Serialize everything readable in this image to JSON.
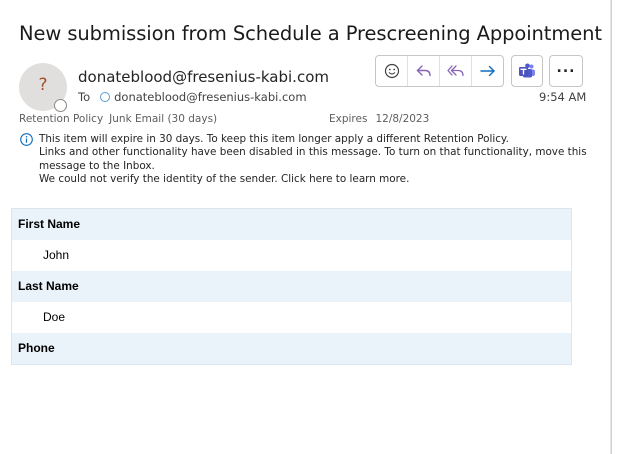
{
  "message": {
    "subject": "New submission from Schedule a Prescreening Appointment",
    "avatar_initial": "?",
    "sender": "donateblood@fresenius-kabi.com",
    "to_label": "To",
    "recipient": "donateblood@fresenius-kabi.com",
    "time": "9:54 AM",
    "retention_label": "Retention Policy",
    "retention_value": "Junk Email (30 days)",
    "expires_label": "Expires",
    "expires_value": "12/8/2023",
    "notice_lines": [
      "This item will expire in 30 days. To keep this item longer apply a different Retention Policy.",
      "Links and other functionality have been disabled in this message. To turn on that functionality, move this message to the Inbox.",
      "We could not verify the identity of the sender. Click here to learn more."
    ]
  },
  "toolbar": {
    "icons": [
      "emoji-react-icon",
      "reply-icon",
      "reply-all-icon",
      "forward-icon",
      "teams-icon",
      "more-options-icon"
    ],
    "more_label": "..."
  },
  "form": {
    "rows": [
      {
        "label": "First Name",
        "value": "John"
      },
      {
        "label": "Last Name",
        "value": "Doe"
      },
      {
        "label": "Phone",
        "value": ""
      }
    ]
  },
  "colors": {
    "accent": "#0f6cbd",
    "reply_purple": "#8764b8",
    "teams": "#4b53bc",
    "header_row_bg": "#eaf2fa"
  }
}
